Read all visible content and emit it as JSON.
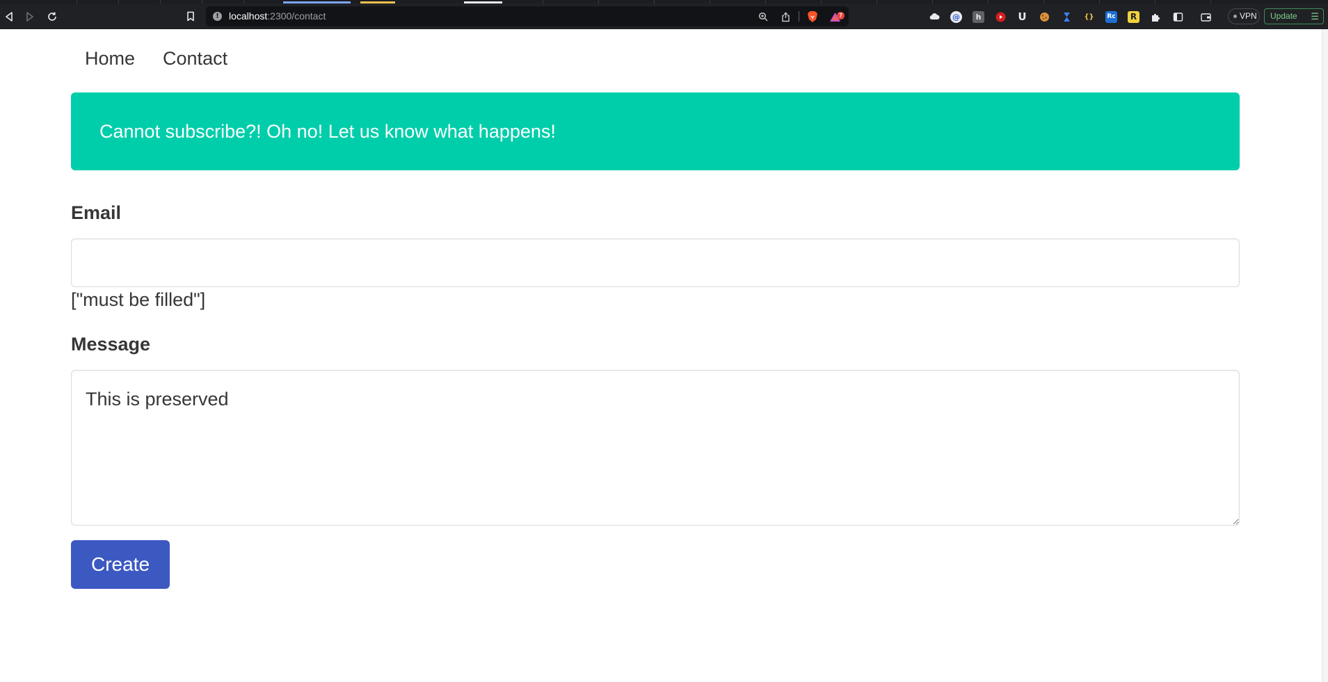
{
  "browser": {
    "url_host": "localhost",
    "url_path": ":2300/contact",
    "shield_badge": "7",
    "vpn_label": "VPN",
    "update_label": "Update",
    "accent_brave": "#fb542b",
    "extensions": [
      "cloud-icon",
      "at-sign-icon",
      "h-icon",
      "youtube-icon",
      "u-icon",
      "cookie-icon",
      "hourglass-icon",
      "braces-icon",
      "rc-icon",
      "r-icon",
      "puzzle-icon",
      "sidebar-icon",
      "wallet-icon"
    ]
  },
  "nav": {
    "items": [
      {
        "label": "Home"
      },
      {
        "label": "Contact"
      }
    ]
  },
  "notification": {
    "text": "Cannot subscribe?! Oh no! Let us know what happens!",
    "color": "#00ceaa"
  },
  "form": {
    "email_label": "Email",
    "email_value": "",
    "email_error": "[\"must be filled\"]",
    "message_label": "Message",
    "message_value": "This is preserved",
    "submit_label": "Create",
    "submit_color": "#3c59c2"
  }
}
